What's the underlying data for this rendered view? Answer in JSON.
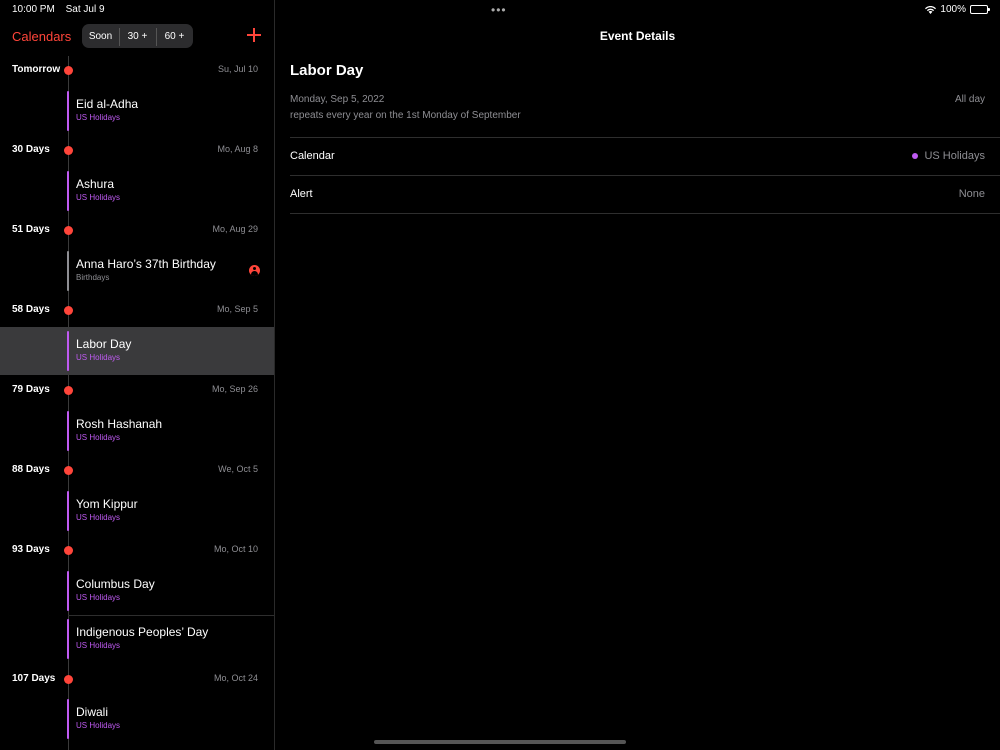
{
  "status_bar": {
    "time": "10:00 PM",
    "date": "Sat Jul 9",
    "battery": "100%"
  },
  "sidebar": {
    "calendars_label": "Calendars",
    "segments": [
      "Soon",
      "30 +",
      "60 +"
    ],
    "groups": [
      {
        "relative": "Tomorrow",
        "date": "Su, Jul 10"
      },
      {
        "relative": "30 Days",
        "date": "Mo, Aug 8"
      },
      {
        "relative": "51 Days",
        "date": "Mo, Aug 29"
      },
      {
        "relative": "58 Days",
        "date": "Mo, Sep 5"
      },
      {
        "relative": "79 Days",
        "date": "Mo, Sep 26"
      },
      {
        "relative": "88 Days",
        "date": "We, Oct 5"
      },
      {
        "relative": "93 Days",
        "date": "Mo, Oct 10"
      },
      {
        "relative": "107 Days",
        "date": "Mo, Oct 24"
      }
    ],
    "events": [
      {
        "title": "Eid al-Adha",
        "calendar": "US Holidays"
      },
      {
        "title": "Ashura",
        "calendar": "US Holidays"
      },
      {
        "title": "Anna Haro’s 37th Birthday",
        "calendar": "Birthdays"
      },
      {
        "title": "Labor Day",
        "calendar": "US Holidays"
      },
      {
        "title": "Rosh Hashanah",
        "calendar": "US Holidays"
      },
      {
        "title": "Yom Kippur",
        "calendar": "US Holidays"
      },
      {
        "title": "Columbus Day",
        "calendar": "US Holidays"
      },
      {
        "title": "Indigenous Peoples’ Day",
        "calendar": "US Holidays"
      },
      {
        "title": "Diwali",
        "calendar": "US Holidays"
      }
    ]
  },
  "detail": {
    "nav_title": "Event Details",
    "title": "Labor Day",
    "date": "Monday, Sep 5, 2022",
    "all_day": "All day",
    "repeat": "repeats every year on the 1st Monday of September",
    "calendar_label": "Calendar",
    "calendar_value": "US Holidays",
    "alert_label": "Alert",
    "alert_value": "None"
  },
  "colors": {
    "accent": "#ff453a",
    "us_holidays": "#bf5af2",
    "birthdays": "#8e8e93",
    "selected_row": "#3a3a3c"
  }
}
